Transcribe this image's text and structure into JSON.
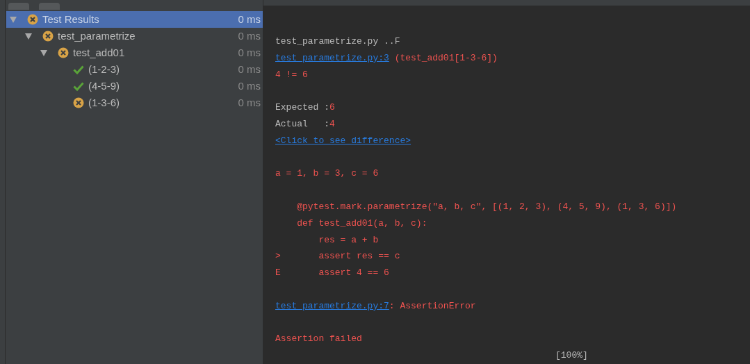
{
  "tree": [
    {
      "label": "Test Results",
      "time": "0 ms",
      "kind": "failed",
      "expanded": true,
      "selected": true,
      "children": [
        {
          "label": "test_parametrize",
          "time": "0 ms",
          "kind": "failed",
          "expanded": true,
          "selected": false,
          "children": [
            {
              "label": "test_add01",
              "time": "0 ms",
              "kind": "failed",
              "expanded": true,
              "selected": false,
              "children": [
                {
                  "label": "(1-2-3)",
                  "time": "0 ms",
                  "kind": "passed",
                  "selected": false
                },
                {
                  "label": "(4-5-9)",
                  "time": "0 ms",
                  "kind": "passed",
                  "selected": false
                },
                {
                  "label": "(1-3-6)",
                  "time": "0 ms",
                  "kind": "failed",
                  "selected": false
                }
              ]
            }
          ]
        }
      ]
    }
  ],
  "console": [
    {
      "kind": "blank"
    },
    {
      "kind": "text",
      "segments": [
        {
          "kind": "plain",
          "text": "test_parametrize.py ..F"
        }
      ]
    },
    {
      "kind": "text",
      "segments": [
        {
          "kind": "link",
          "text": "test_parametrize.py:3"
        },
        {
          "kind": "error",
          "text": " (test_add01[1-3-6])"
        }
      ]
    },
    {
      "kind": "text",
      "segments": [
        {
          "kind": "error",
          "text": "4 != 6"
        }
      ]
    },
    {
      "kind": "blank"
    },
    {
      "kind": "text",
      "segments": [
        {
          "kind": "plain",
          "text": "Expected :"
        },
        {
          "kind": "error",
          "text": "6"
        }
      ]
    },
    {
      "kind": "text",
      "segments": [
        {
          "kind": "plain",
          "text": "Actual   :"
        },
        {
          "kind": "error",
          "text": "4"
        }
      ]
    },
    {
      "kind": "text",
      "segments": [
        {
          "kind": "link",
          "text": "<Click to see difference>"
        }
      ]
    },
    {
      "kind": "blank"
    },
    {
      "kind": "text",
      "segments": [
        {
          "kind": "error",
          "text": "a = 1, b = 3, c = 6"
        }
      ]
    },
    {
      "kind": "blank"
    },
    {
      "kind": "text",
      "segments": [
        {
          "kind": "error",
          "text": "    @pytest.mark.parametrize(\"a, b, c\", [(1, 2, 3), (4, 5, 9), (1, 3, 6)])"
        }
      ]
    },
    {
      "kind": "text",
      "segments": [
        {
          "kind": "error",
          "text": "    def test_add01(a, b, c):"
        }
      ]
    },
    {
      "kind": "text",
      "segments": [
        {
          "kind": "error",
          "text": "        res = a + b"
        }
      ]
    },
    {
      "kind": "text",
      "segments": [
        {
          "kind": "error",
          "text": ">       assert res == c"
        }
      ]
    },
    {
      "kind": "text",
      "segments": [
        {
          "kind": "error",
          "text": "E       assert 4 == 6"
        }
      ]
    },
    {
      "kind": "blank"
    },
    {
      "kind": "text",
      "segments": [
        {
          "kind": "link",
          "text": "test_parametrize.py:7"
        },
        {
          "kind": "error",
          "text": ": AssertionError"
        }
      ]
    },
    {
      "kind": "blank"
    },
    {
      "kind": "text",
      "segments": [
        {
          "kind": "error",
          "text": "Assertion failed"
        }
      ]
    },
    {
      "kind": "progress",
      "segments": [
        {
          "kind": "plain",
          "text": "[100%]"
        }
      ]
    }
  ]
}
